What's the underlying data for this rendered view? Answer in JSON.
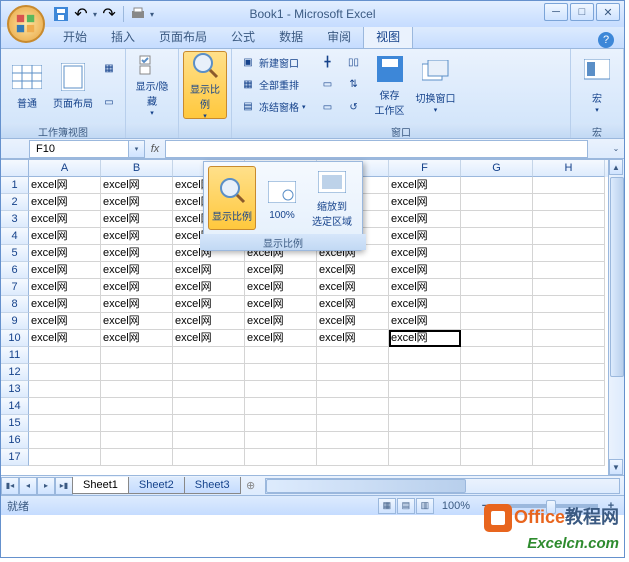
{
  "window": {
    "title": "Book1 - Microsoft Excel"
  },
  "tabs": {
    "items": [
      "开始",
      "插入",
      "页面布局",
      "公式",
      "数据",
      "审阅",
      "视图"
    ],
    "active": 6
  },
  "ribbon": {
    "group1": {
      "label": "工作簿视图",
      "normal": "普通",
      "pagelayout": "页面布局"
    },
    "group2": {
      "showhide": "显示/隐藏"
    },
    "group3": {
      "zoom": "显示比例"
    },
    "group4": {
      "label": "窗口",
      "newwin": "新建窗口",
      "arrange": "全部重排",
      "freeze": "冻结窗格",
      "save": "保存\n工作区",
      "switch": "切换窗口"
    },
    "group5": {
      "label": "宏",
      "macro": "宏"
    }
  },
  "zoompopup": {
    "label": "显示比例",
    "zoom": "显示比例",
    "hundred": "100%",
    "fit": "缩放到\n选定区域"
  },
  "namebox": "F10",
  "columns": [
    "A",
    "B",
    "C",
    "D",
    "E",
    "F",
    "G",
    "H"
  ],
  "cellvalue": "excel网",
  "filledCols": 6,
  "filledRows": 10,
  "totalRows": 17,
  "sheets": {
    "s1": "Sheet1",
    "s2": "Sheet2",
    "s3": "Sheet3"
  },
  "status": {
    "ready": "就绪",
    "zoom": "100%"
  },
  "watermark1a": "Office",
  "watermark1b": "教程网",
  "watermark2": "Excelcn.com"
}
